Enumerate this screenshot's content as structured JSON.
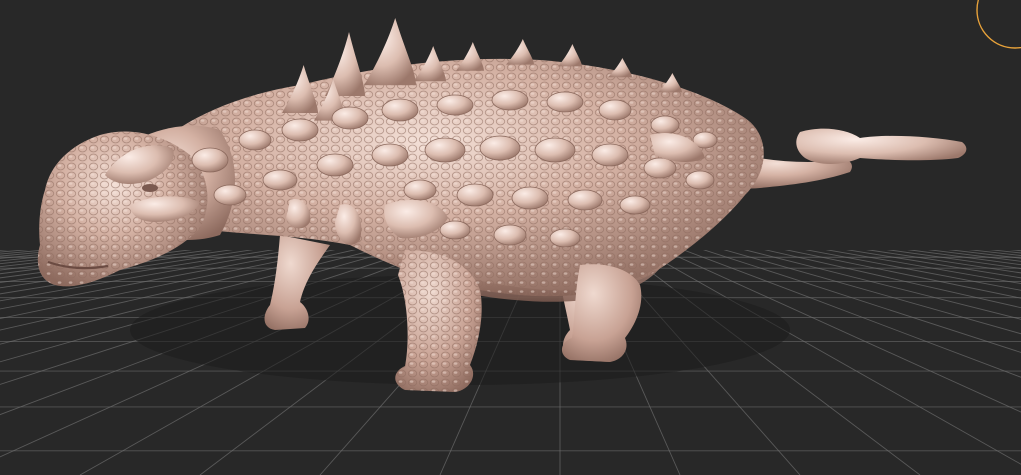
{
  "viewport": {
    "background_color": "#282828",
    "grid_color": "#6e6e6e",
    "model_color": "#c9a697",
    "model_highlight_color": "#f2ddd5",
    "model_shadow_color": "#7a5a50",
    "gizmo_color": "#e8a23a"
  },
  "scene": {
    "model": "ankylosaur-sculpt",
    "grid": true,
    "gizmo": "orbit-ring"
  }
}
